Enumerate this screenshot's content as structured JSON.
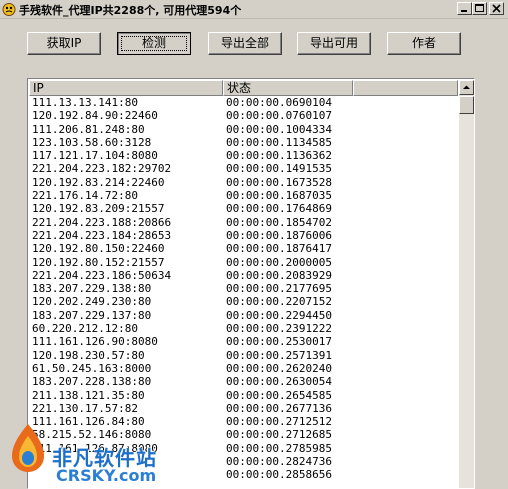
{
  "window": {
    "title": "手残软件_代理IP共2288个, 可用代理594个"
  },
  "toolbar": {
    "get_ip": "获取IP",
    "check": "检测",
    "export_all": "导出全部",
    "export_available": "导出可用",
    "author": "作者"
  },
  "list": {
    "columns": [
      "IP",
      "状态",
      ""
    ],
    "rows": [
      [
        "111.13.13.141:80",
        "00:00:00.0690104"
      ],
      [
        "120.192.84.90:22460",
        "00:00:00.0760107"
      ],
      [
        "111.206.81.248:80",
        "00:00:00.1004334"
      ],
      [
        "123.103.58.60:3128",
        "00:00:00.1134585"
      ],
      [
        "117.121.17.104:8080",
        "00:00:00.1136362"
      ],
      [
        "221.204.223.182:29702",
        "00:00:00.1491535"
      ],
      [
        "120.192.83.214:22460",
        "00:00:00.1673528"
      ],
      [
        "221.176.14.72:80",
        "00:00:00.1687035"
      ],
      [
        "120.192.83.209:21557",
        "00:00:00.1764869"
      ],
      [
        "221.204.223.188:20866",
        "00:00:00.1854702"
      ],
      [
        "221.204.223.184:28653",
        "00:00:00.1876006"
      ],
      [
        "120.192.80.150:22460",
        "00:00:00.1876417"
      ],
      [
        "120.192.80.152:21557",
        "00:00:00.2000005"
      ],
      [
        "221.204.223.186:50634",
        "00:00:00.2083929"
      ],
      [
        "183.207.229.138:80",
        "00:00:00.2177695"
      ],
      [
        "120.202.249.230:80",
        "00:00:00.2207152"
      ],
      [
        "183.207.229.137:80",
        "00:00:00.2294450"
      ],
      [
        "60.220.212.12:80",
        "00:00:00.2391222"
      ],
      [
        "111.161.126.90:8080",
        "00:00:00.2530017"
      ],
      [
        "120.198.230.57:80",
        "00:00:00.2571391"
      ],
      [
        "61.50.245.163:8000",
        "00:00:00.2620240"
      ],
      [
        "183.207.228.138:80",
        "00:00:00.2630054"
      ],
      [
        "211.138.121.35:80",
        "00:00:00.2654585"
      ],
      [
        "221.130.17.57:82",
        "00:00:00.2677136"
      ],
      [
        "111.161.126.84:80",
        "00:00:00.2712512"
      ],
      [
        "58.215.52.146:8080",
        "00:00:00.2712685"
      ],
      [
        "111.161.126.87:8080",
        "00:00:00.2785985"
      ],
      [
        "",
        "00:00:00.2824736"
      ],
      [
        "",
        "00:00:00.2858656"
      ]
    ]
  },
  "watermark": {
    "text_cn": "非凡软件站",
    "text_en": "CRSKY.com"
  },
  "colors": {
    "face": "#d4d0c8",
    "watermark": "#1e6fc8"
  }
}
